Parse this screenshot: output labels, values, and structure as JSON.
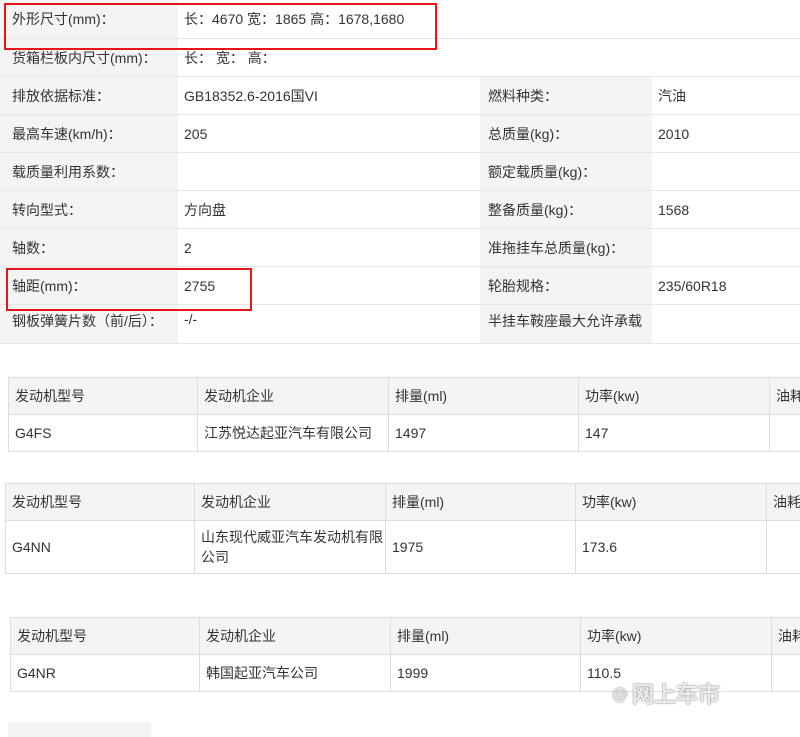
{
  "specs": {
    "row1": {
      "label": "外形尺寸(mm)：",
      "value": "长：4670 宽：1865 高：1678,1680"
    },
    "row2": {
      "label": "货箱栏板内尺寸(mm)：",
      "value": "长： 宽： 高："
    },
    "row3": {
      "label": "排放依据标准：",
      "value": "GB18352.6-2016国VI",
      "label2": "燃料种类：",
      "value2": "汽油"
    },
    "row4": {
      "label": "最高车速(km/h)：",
      "value": "205",
      "label2": "总质量(kg)：",
      "value2": "2010"
    },
    "row5": {
      "label": "载质量利用系数：",
      "value": "",
      "label2": "额定载质量(kg)：",
      "value2": ""
    },
    "row6": {
      "label": "转向型式：",
      "value": "方向盘",
      "label2": "整备质量(kg)：",
      "value2": "1568"
    },
    "row7": {
      "label": "轴数：",
      "value": "2",
      "label2": "准拖挂车总质量(kg)：",
      "value2": ""
    },
    "row8": {
      "label": "轴距(mm)：",
      "value": "2755",
      "label2": "轮胎规格：",
      "value2": "235/60R18"
    },
    "row9": {
      "label": "钢板弹簧片数（前/后）：",
      "value": "-/-",
      "label2": "半挂车鞍座最大允许承载",
      "value2": ""
    }
  },
  "engines": [
    {
      "headers": [
        "发动机型号",
        "发动机企业",
        "排量(ml)",
        "功率(kw)",
        "油耗"
      ],
      "values": [
        "G4FS",
        "江苏悦达起亚汽车有限公司",
        "1497",
        "147",
        ""
      ]
    },
    {
      "headers": [
        "发动机型号",
        "发动机企业",
        "排量(ml)",
        "功率(kw)",
        "油耗"
      ],
      "values": [
        "G4NN",
        "山东现代威亚汽车发动机有限公司",
        "1975",
        "173.6",
        ""
      ]
    },
    {
      "headers": [
        "发动机型号",
        "发动机企业",
        "排量(ml)",
        "功率(kw)",
        "油耗"
      ],
      "values": [
        "G4NR",
        "韩国起亚汽车公司",
        "1999",
        "110.5",
        ""
      ]
    }
  ],
  "colors": {
    "highlight": "#e8141c",
    "label_bg": "#f4f4f4"
  },
  "watermark": {
    "text": "网上车市",
    "icon": "@"
  }
}
